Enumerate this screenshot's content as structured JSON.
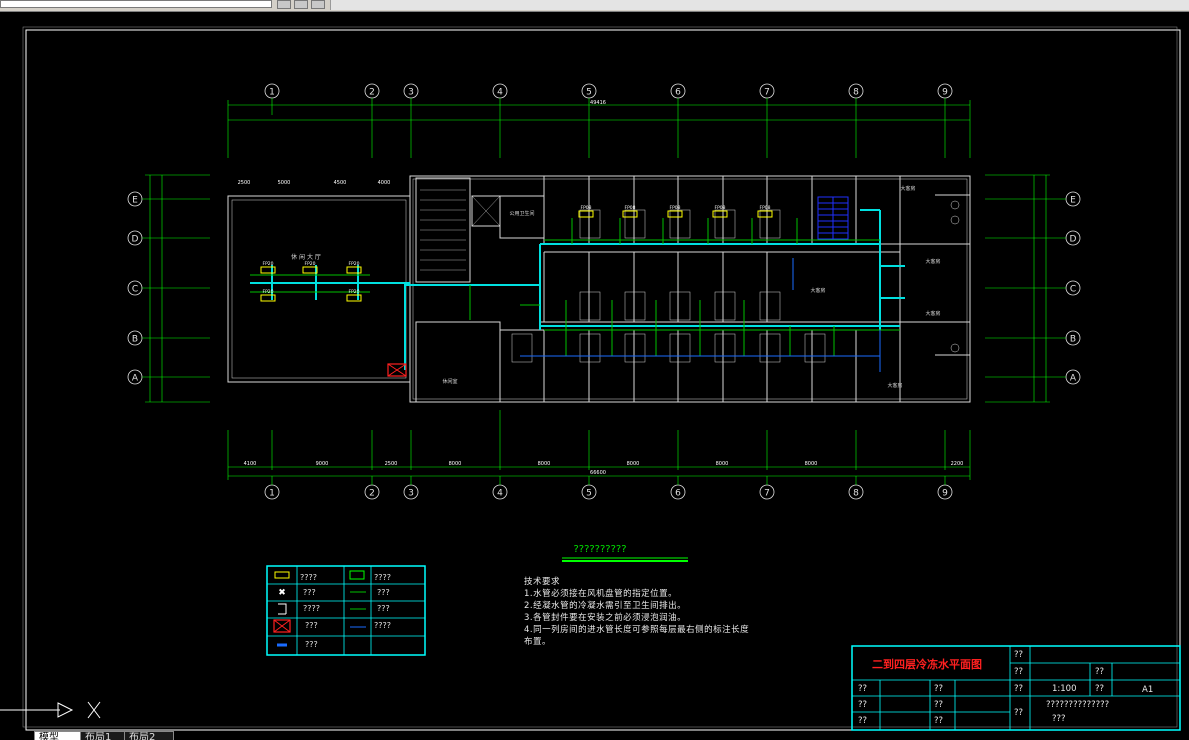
{
  "toolbar": {},
  "tabs": [
    {
      "label": "模型"
    },
    {
      "label": "布局1"
    },
    {
      "label": "布局2"
    }
  ],
  "grid": {
    "columns": [
      "1",
      "2",
      "3",
      "4",
      "5",
      "6",
      "7",
      "8",
      "9"
    ],
    "rows": [
      "E",
      "D",
      "C",
      "B",
      "A"
    ]
  },
  "dimensions": {
    "top_total": "49416",
    "bottom_total": "66600",
    "bottom_segments": [
      "4100",
      "9000",
      "2500",
      "8000",
      "8000",
      "8000",
      "8000",
      "8000",
      "2200"
    ],
    "top_left_segments": [
      "2500",
      "5000",
      "4500",
      "4000"
    ]
  },
  "rooms": {
    "lobby": "休 闲 大 厅",
    "storage": "休闲室",
    "suite": "大客房",
    "office": "公用卫生间"
  },
  "units": [
    "FP20",
    "FP20",
    "FP20",
    "FP20",
    "FP20",
    "FP08",
    "FP08",
    "FP08",
    "FP08",
    "FP08"
  ],
  "drawing_subtitle": "??????????",
  "notes": {
    "title": "技术要求",
    "lines": [
      "1.水管必须接在风机盘管的指定位置。",
      "2.经凝水管的冷凝水需引至卫生间排出。",
      "3.各管封件要在安装之前必须浸泡润油。",
      "4.同一列房间的进水管长度可参照每层最右侧的标注长度",
      "布置。"
    ]
  },
  "legend": [
    {
      "symbol": "fan-coil",
      "label": "????"
    },
    {
      "symbol": "air-unit",
      "label": "????"
    },
    {
      "symbol": "cross",
      "label": "???"
    },
    {
      "symbol": "line-green",
      "label": "???"
    },
    {
      "symbol": "valve",
      "label": "????"
    },
    {
      "symbol": "line-green-2",
      "label": "???"
    },
    {
      "symbol": "box-red",
      "label": "???"
    },
    {
      "symbol": "line-blue",
      "label": "????"
    },
    {
      "symbol": "dash-blue",
      "label": "???"
    }
  ],
  "title_block": {
    "title": "二到四层冷冻水平面图",
    "scale": "1:100",
    "sheet": "A1",
    "placeholder": "??",
    "description": "??????????????",
    "description2": "???"
  },
  "colors": {
    "background": "#000000",
    "wall": "#d8d8d8",
    "pipe_cyan": "#00e0e0",
    "pipe_green": "#00c000",
    "dim_green": "#00ff00",
    "frame": "#ffffff",
    "title_red": "#ff2020",
    "unit_yellow": "#ffff00",
    "title_block_cyan": "#00ffff"
  }
}
